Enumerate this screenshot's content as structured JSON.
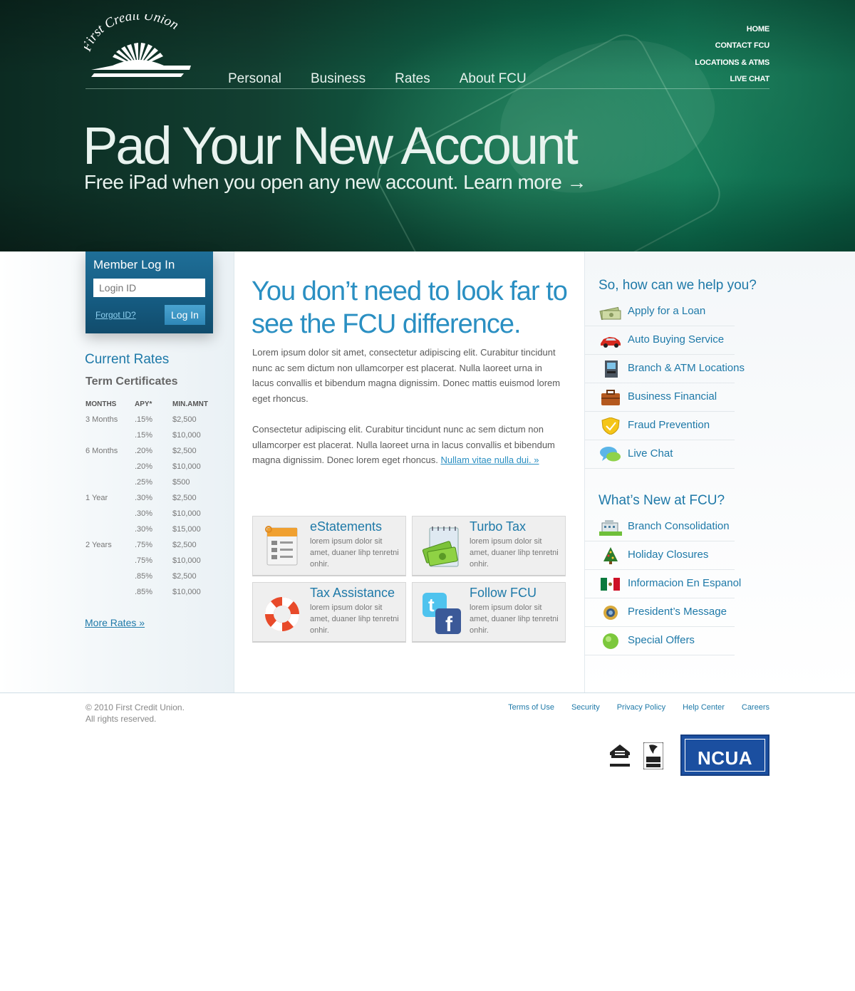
{
  "brand": {
    "name": "First Credit Union"
  },
  "main_nav": [
    "Personal",
    "Business",
    "Rates",
    "About FCU"
  ],
  "top_nav": [
    "HOME",
    "CONTACT FCU",
    "LOCATIONS & ATMS",
    "LIVE CHAT"
  ],
  "hero": {
    "title": "Pad Your New Account",
    "subtitle": "Free iPad when you open any new account. Learn more →"
  },
  "login": {
    "title": "Member Log In",
    "placeholder": "Login ID",
    "forgot": "Forgot ID?",
    "button": "Log In"
  },
  "rates": {
    "title": "Current Rates",
    "subtitle": "Term Certificates",
    "headers": [
      "MONTHS",
      "APY*",
      "MIN.AMNT"
    ],
    "rows": [
      [
        "3 Months",
        ".15%",
        "$2,500"
      ],
      [
        "",
        ".15%",
        "$10,000"
      ],
      [
        "6 Months",
        ".20%",
        "$2,500"
      ],
      [
        "",
        ".20%",
        "$10,000"
      ],
      [
        "",
        ".25%",
        "$500"
      ],
      [
        "1 Year",
        ".30%",
        "$2,500"
      ],
      [
        "",
        ".30%",
        "$10,000"
      ],
      [
        "",
        ".30%",
        "$15,000"
      ],
      [
        "2 Years",
        ".75%",
        "$2,500"
      ],
      [
        "",
        ".75%",
        "$10,000"
      ],
      [
        "",
        ".85%",
        "$2,500"
      ],
      [
        "",
        ".85%",
        "$10,000"
      ]
    ],
    "more": "More Rates »"
  },
  "center": {
    "headline": "You don’t need to look far to see the FCU difference.",
    "para1": "Lorem ipsum dolor sit amet, consectetur adipiscing elit. Curabitur tincidunt nunc ac sem dictum non ullamcorper est placerat. Nulla laoreet urna in lacus convallis et bibendum magna dignissim. Donec mattis euismod lorem eget rhoncus.",
    "para2": "Consectetur adipiscing elit. Curabitur tincidunt nunc ac sem dictum non ullamcorper est placerat. Nulla laoreet urna in lacus convallis et bibendum magna dignissim. Donec lorem eget rhoncus.",
    "para2_link": "Nullam vitae nulla dui. »",
    "features": [
      {
        "title": "eStatements",
        "text": "lorem ipsum dolor sit amet, duaner lihp tenretni onhir.",
        "icon": "document-icon"
      },
      {
        "title": "Turbo Tax",
        "text": "lorem ipsum dolor sit amet, duaner lihp tenretni onhir.",
        "icon": "money-notepad-icon"
      },
      {
        "title": "Tax Assistance",
        "text": "lorem ipsum dolor sit amet, duaner lihp tenretni onhir.",
        "icon": "lifebuoy-icon"
      },
      {
        "title": "Follow FCU",
        "text": "lorem ipsum dolor sit amet, duaner lihp tenretni onhir.",
        "icon": "twitter-facebook-icon"
      }
    ]
  },
  "help": {
    "title": "So, how can we help you?",
    "items": [
      {
        "label": "Apply for a Loan",
        "icon": "cash-icon"
      },
      {
        "label": "Auto Buying Service",
        "icon": "car-icon"
      },
      {
        "label": "Branch & ATM Locations",
        "icon": "atm-icon"
      },
      {
        "label": "Business Financial",
        "icon": "briefcase-icon"
      },
      {
        "label": "Fraud Prevention",
        "icon": "shield-icon"
      },
      {
        "label": "Live Chat",
        "icon": "chat-bubble-icon"
      }
    ]
  },
  "whats_new": {
    "title": "What’s New at FCU?",
    "items": [
      {
        "label": "Branch Consolidation",
        "icon": "building-icon"
      },
      {
        "label": "Holiday Closures",
        "icon": "tree-icon"
      },
      {
        "label": "Informacion En Espanol",
        "icon": "mexico-flag-icon"
      },
      {
        "label": "President’s Message",
        "icon": "megaphone-icon"
      },
      {
        "label": "Special Offers",
        "icon": "green-dot-icon"
      }
    ]
  },
  "footer": {
    "copyright_line1": "© 2010 First Credit Union.",
    "copyright_line2": "All rights reserved.",
    "links": [
      "Terms of Use",
      "Security",
      "Privacy Policy",
      "Help Center",
      "Careers"
    ],
    "badges": {
      "ncua": "NCUA"
    }
  },
  "colors": {
    "accent": "#1e79a8",
    "hero_green": "#0f6a4c",
    "login_blue": "#155b81"
  }
}
